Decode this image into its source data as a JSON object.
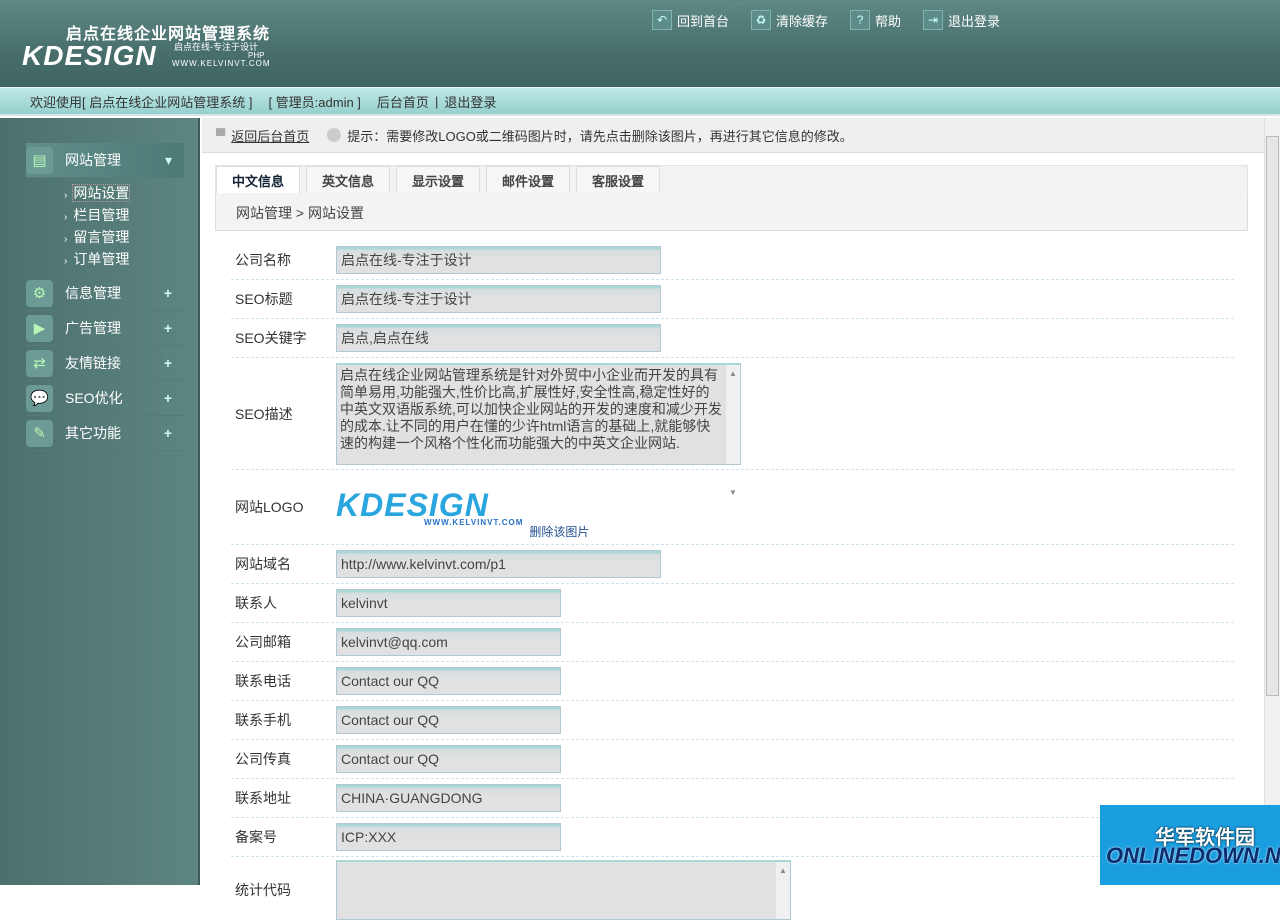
{
  "header": {
    "system_name": "启点在线企业网站管理系统",
    "logo_text": "KDESIGN",
    "slogan": "启点在线-专注于设计",
    "edition": "PHP",
    "site_url": "WWW.KELVINVT.COM",
    "nav": [
      {
        "label": "回到首台",
        "icon": "back-arrow-icon"
      },
      {
        "label": "清除缓存",
        "icon": "trash-icon"
      },
      {
        "label": "帮助",
        "icon": "help-icon"
      },
      {
        "label": "退出登录",
        "icon": "logout-icon"
      }
    ]
  },
  "welcome_bar": {
    "welcome": "欢迎使用[ 启点在线企业网站管理系统 ]",
    "admin": "[ 管理员:admin ]",
    "home": "后台首页",
    "sep": "|",
    "logout": "退出登录"
  },
  "sidebar": {
    "menus": [
      {
        "label": "网站管理",
        "icon": "document-icon",
        "toggle": "▾",
        "submenu": [
          "网站设置",
          "栏目管理",
          "留言管理",
          "订单管理"
        ]
      },
      {
        "label": "信息管理",
        "icon": "gears-icon",
        "toggle": "+"
      },
      {
        "label": "广告管理",
        "icon": "monitor-play-icon",
        "toggle": "+"
      },
      {
        "label": "友情链接",
        "icon": "link-arrows-icon",
        "toggle": "+"
      },
      {
        "label": "SEO优化",
        "icon": "chat-bubble-icon",
        "toggle": "+"
      },
      {
        "label": "其它功能",
        "icon": "tools-icon",
        "toggle": "+"
      }
    ]
  },
  "hint": {
    "back_link": "返回后台首页",
    "text": "提示：需要修改LOGO或二维码图片时，请先点击删除该图片，再进行其它信息的修改。"
  },
  "tabs": [
    "中文信息",
    "英文信息",
    "显示设置",
    "邮件设置",
    "客服设置"
  ],
  "breadcrumb": "网站管理 > 网站设置",
  "form": {
    "company_name": {
      "label": "公司名称",
      "value": "启点在线-专注于设计"
    },
    "seo_title": {
      "label": "SEO标题",
      "value": "启点在线-专注于设计"
    },
    "seo_keywords": {
      "label": "SEO关键字",
      "value": "启点,启点在线"
    },
    "seo_desc": {
      "label": "SEO描述",
      "value": "启点在线企业网站管理系统是针对外贸中小企业而开发的具有简单易用,功能强大,性价比高,扩展性好,安全性高,稳定性好的中英文双语版系统,可以加快企业网站的开发的速度和减少开发的成本.让不同的用户在懂的少许html语言的基础上,就能够快速的构建一个风格个性化而功能强大的中英文企业网站."
    },
    "logo": {
      "label": "网站LOGO",
      "logo_text": "KDESIGN",
      "logo_url": "WWW.KELVINVT.COM",
      "delete": "删除该图片"
    },
    "domain": {
      "label": "网站域名",
      "value": "http://www.kelvinvt.com/p1"
    },
    "contact": {
      "label": "联系人",
      "value": "kelvinvt"
    },
    "email": {
      "label": "公司邮箱",
      "value": "kelvinvt@qq.com"
    },
    "phone": {
      "label": "联系电话",
      "value": "Contact our QQ"
    },
    "mobile": {
      "label": "联系手机",
      "value": "Contact our QQ"
    },
    "fax": {
      "label": "公司传真",
      "value": "Contact our QQ"
    },
    "address": {
      "label": "联系地址",
      "value": "CHINA·GUANGDONG"
    },
    "icp": {
      "label": "备案号",
      "value": "ICP:XXX"
    },
    "stats": {
      "label": "统计代码",
      "value": ""
    }
  },
  "watermark": {
    "cn": "华军软件园",
    "en": "ONLINEDOWN.NET"
  }
}
